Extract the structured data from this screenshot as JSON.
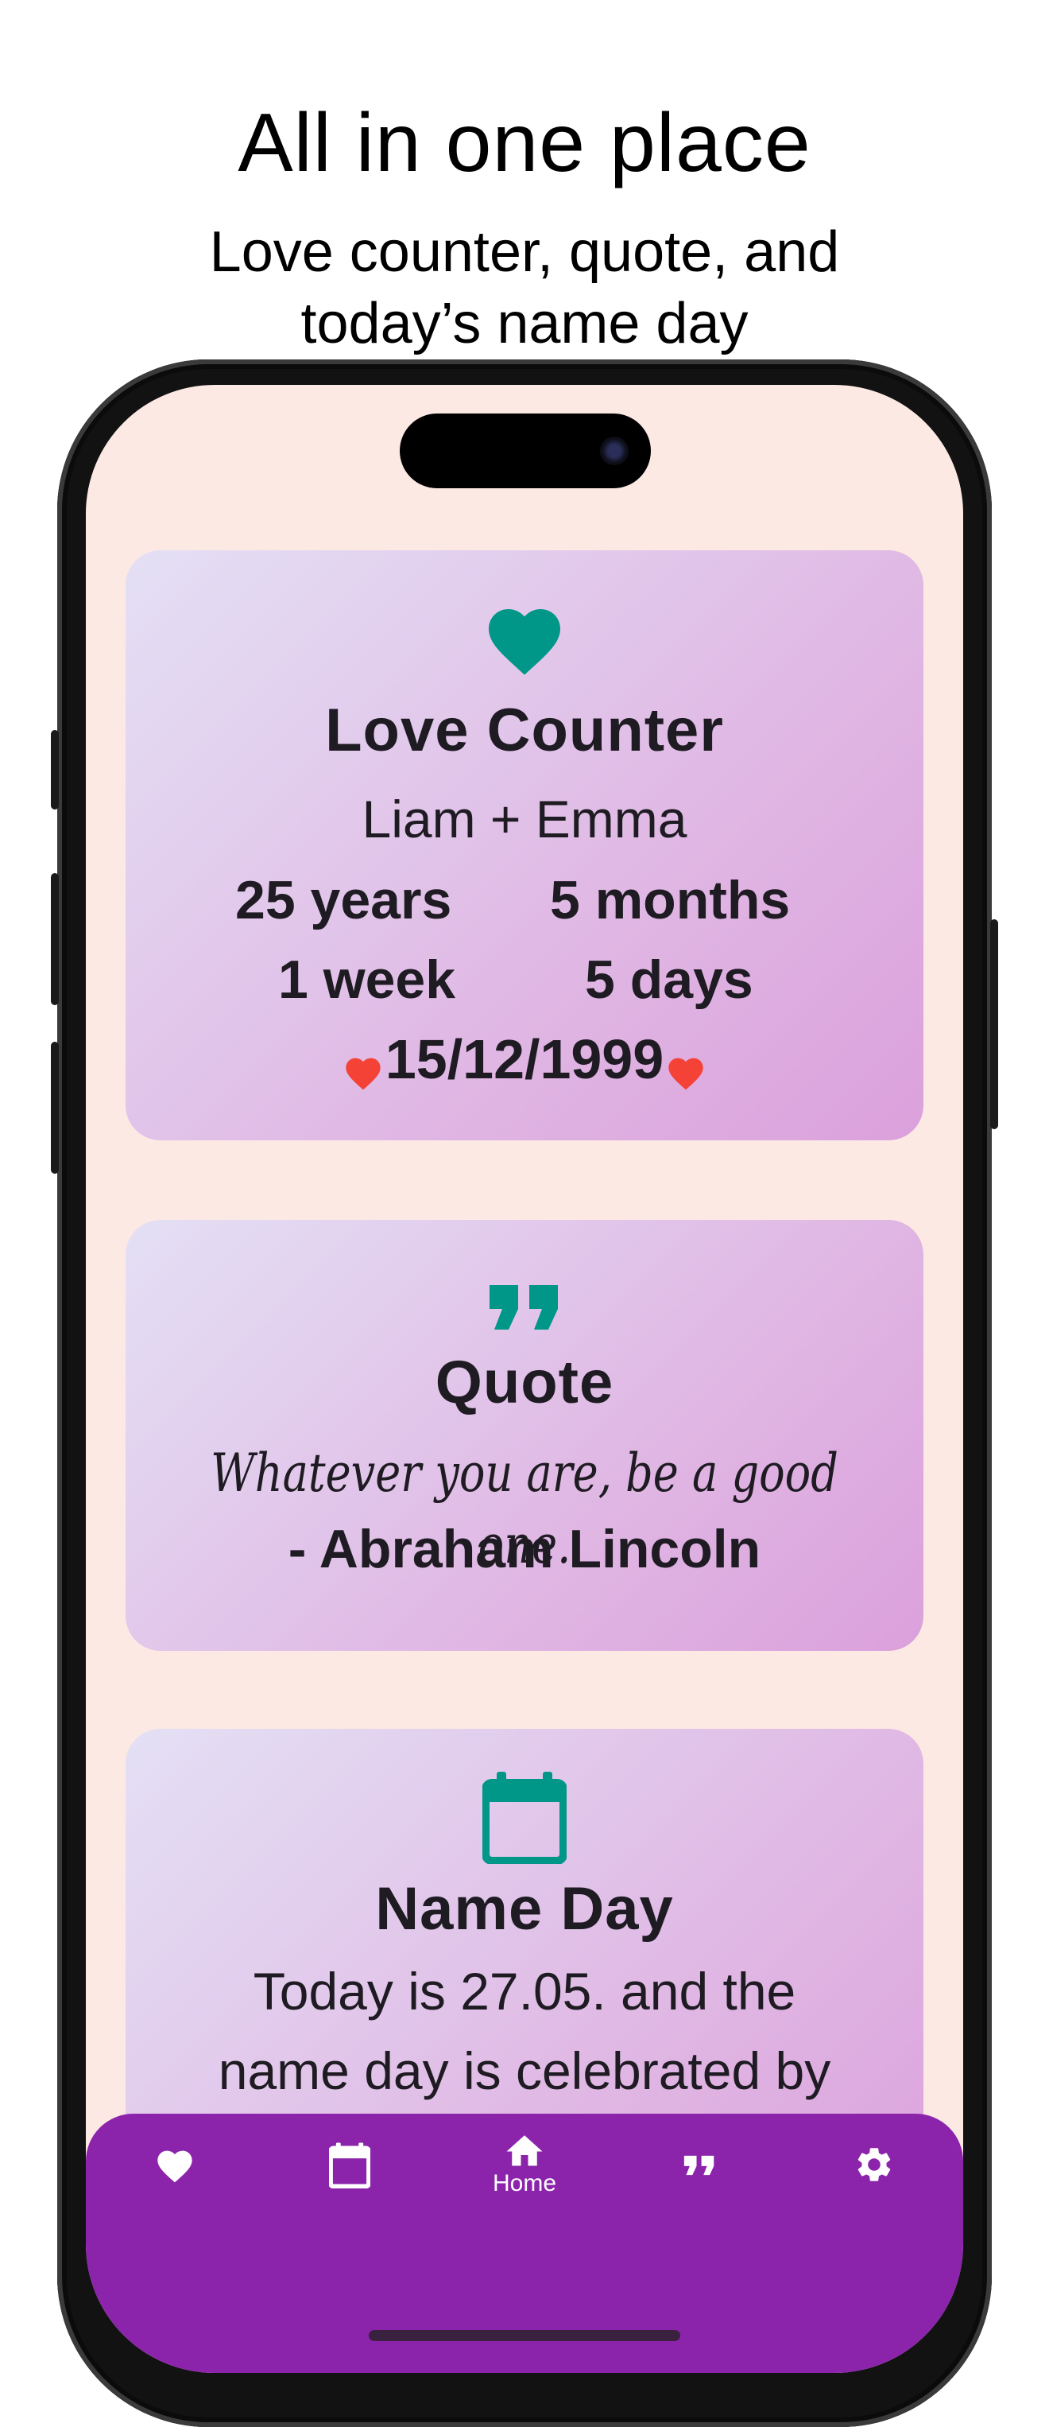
{
  "marketing": {
    "headline": "All in one place",
    "subtitle_line1": "Love counter, quote, and",
    "subtitle_line2": "today’s name day"
  },
  "love_counter": {
    "icon": "heart-icon",
    "title": "Love Counter",
    "couple": "Liam + Emma",
    "years": "25 years",
    "months": "5 months",
    "weeks": "1 week",
    "days": "5 days",
    "date": "15/12/1999"
  },
  "quote": {
    "icon": "quote-icon",
    "title": "Quote",
    "text": "Whatever you are, be a good one.",
    "author": "- Abraham Lincoln"
  },
  "name_day": {
    "icon": "calendar-icon",
    "title": "Name Day",
    "line1": "Today is 27.05. and the",
    "line2": "name day is celebrated by"
  },
  "nav": {
    "items": [
      {
        "icon": "heart-icon",
        "label": ""
      },
      {
        "icon": "calendar-icon",
        "label": ""
      },
      {
        "icon": "home-icon",
        "label": "Home"
      },
      {
        "icon": "quote-icon",
        "label": ""
      },
      {
        "icon": "gear-icon",
        "label": ""
      }
    ],
    "active": "Home"
  },
  "colors": {
    "accent_teal": "#009688",
    "nav_purple": "#8b24ab",
    "screen_background": "#fde9e4",
    "heart_red": "#f44336"
  }
}
